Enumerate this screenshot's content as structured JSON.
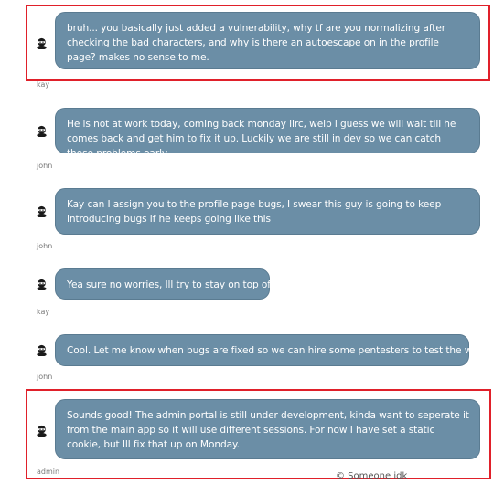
{
  "messages": [
    {
      "author": "kay",
      "text": "bruh... you basically just added a vulnerability, why tf are you normalizing after checking the bad characters, and why is there an autoescape on in the profile page? makes no sense to me."
    },
    {
      "author": "john",
      "text": "He is not at work today, coming back monday iirc, welp i guess we will wait till he comes back and get him to fix it up. Luckily we are still in dev so we can catch these problems early."
    },
    {
      "author": "john",
      "text": "Kay can I assign you to the profile page bugs, I swear this guy is going to keep introducing bugs if he keeps going like this"
    },
    {
      "author": "kay",
      "text": "Yea sure no worries, Ill try to stay on top of it"
    },
    {
      "author": "john",
      "text": "Cool. Let me know when bugs are fixed so we can hire some pentesters to test the website."
    },
    {
      "author": "admin",
      "text": "Sounds good! The admin portal is still under development, kinda want to seperate it from the main app so it will use different sessions. For now I have set a static cookie, but Ill fix that up on Monday."
    }
  ],
  "footer": "© Someone idk",
  "colors": {
    "bubble": "#6b8ea6",
    "highlight": "#e0202a"
  },
  "icons": {
    "avatar": "ninja-avatar-icon"
  }
}
